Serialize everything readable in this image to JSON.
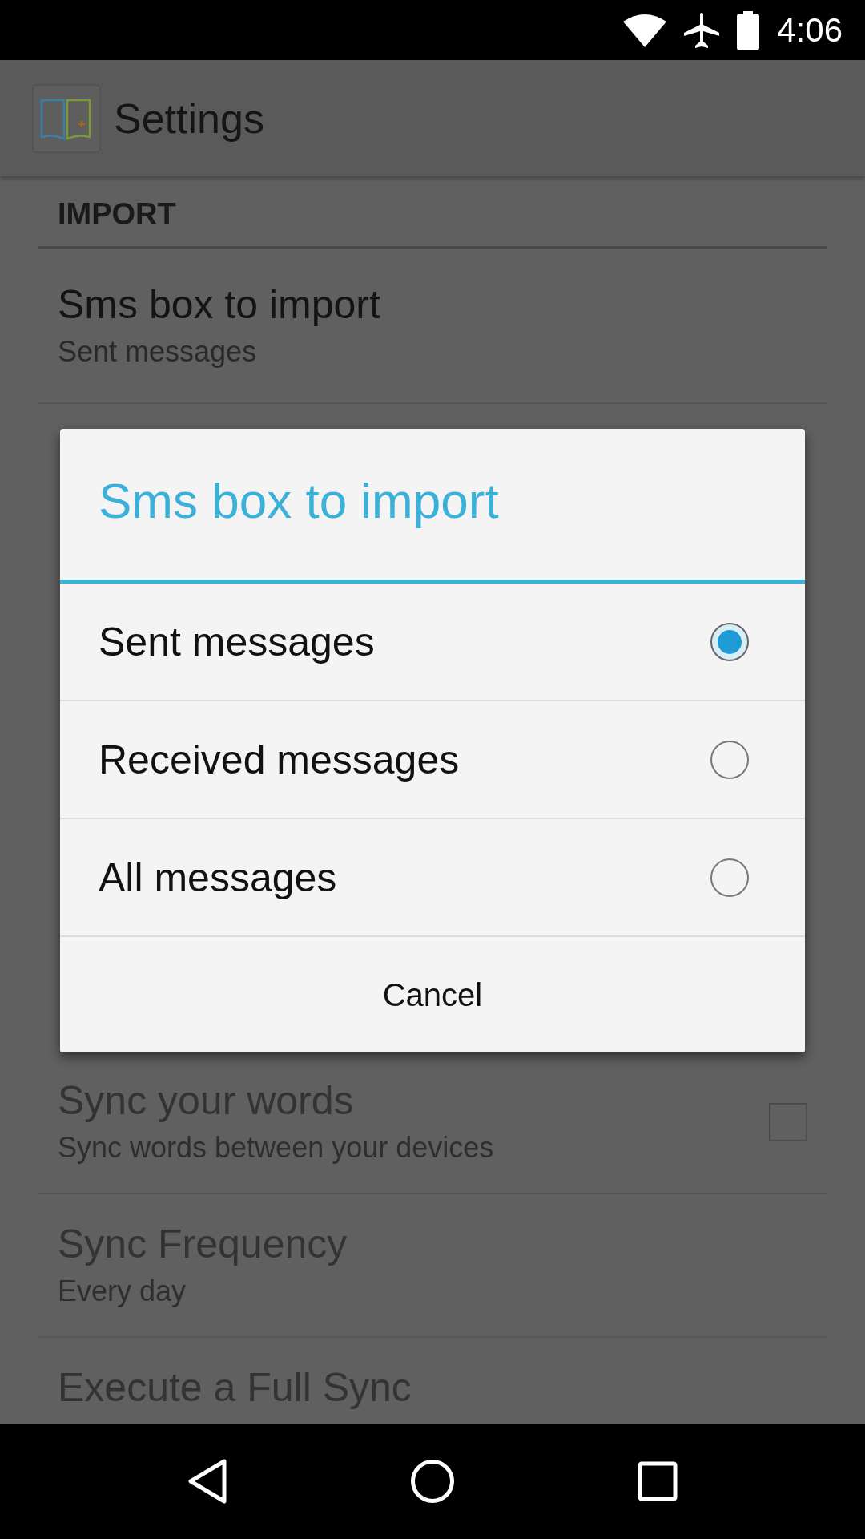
{
  "status_bar": {
    "time": "4:06"
  },
  "app_bar": {
    "title": "Settings"
  },
  "settings": {
    "section": "IMPORT",
    "items_above": [
      {
        "title": "Sms box to import",
        "summary": "Sent messages",
        "disabled": false
      }
    ],
    "items_below": [
      {
        "kind": "checkbox",
        "title": "Sync your words",
        "summary": "Sync words between your devices",
        "disabled": true,
        "checked": false
      },
      {
        "kind": "text",
        "title": "Sync Frequency",
        "summary": "Every day",
        "disabled": true
      },
      {
        "kind": "text",
        "title": "Execute a Full Sync",
        "disabled": true
      }
    ]
  },
  "dialog": {
    "title": "Sms box to import",
    "options": [
      {
        "label": "Sent messages",
        "selected": true
      },
      {
        "label": "Received messages",
        "selected": false
      },
      {
        "label": "All messages",
        "selected": false
      }
    ],
    "button": "Cancel"
  }
}
